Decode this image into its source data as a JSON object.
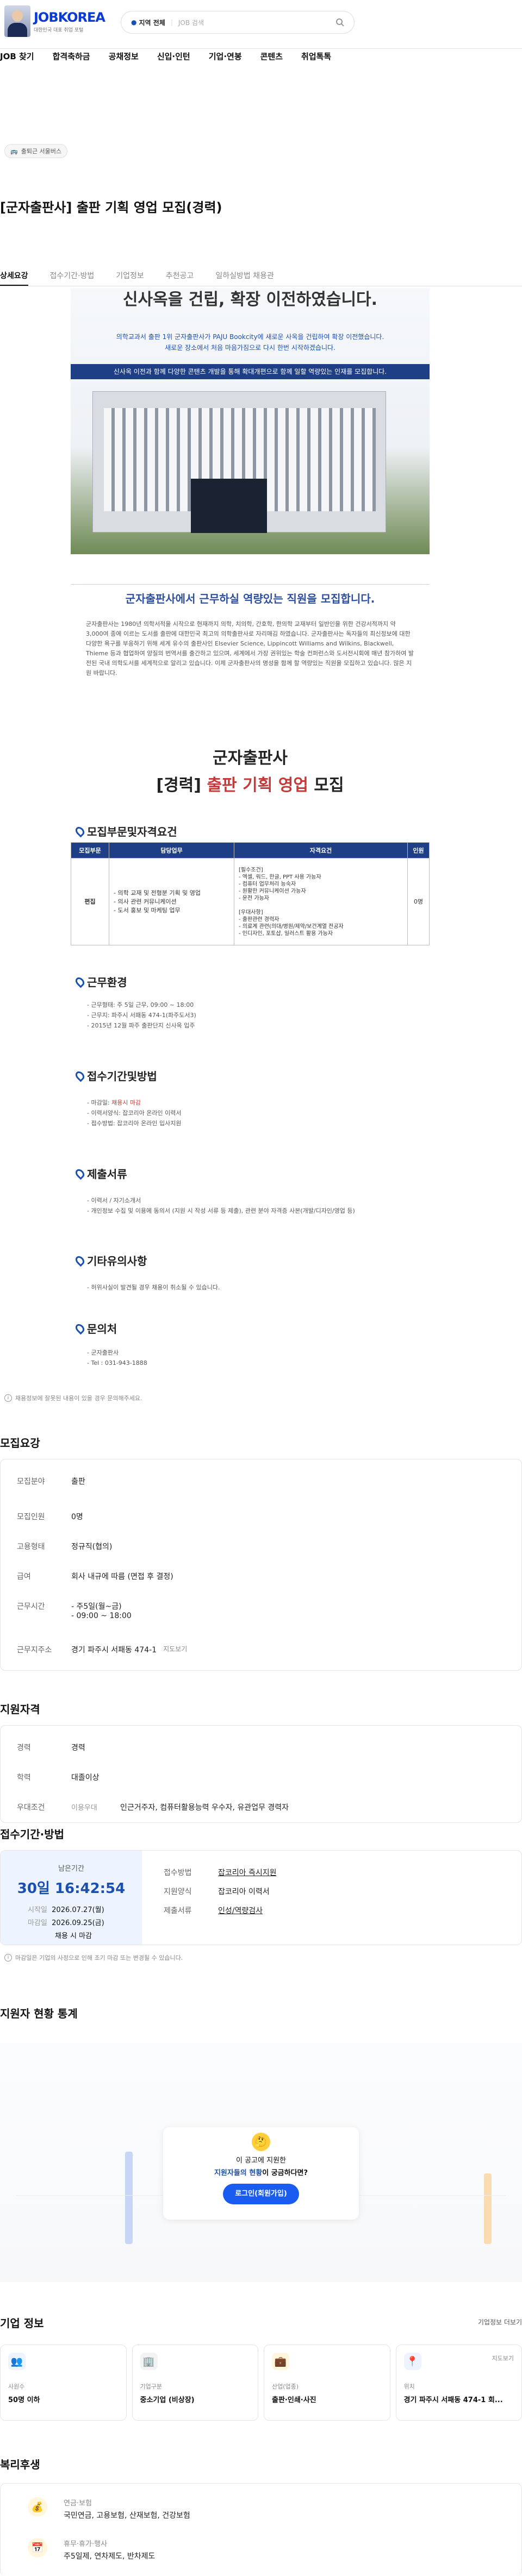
{
  "header": {
    "logo": "JOBKOREA",
    "logo_sub": "대한민국 대표 취업 포털",
    "location": "지역 전체",
    "search_placeholder": "JOB 검색"
  },
  "nav": [
    "JOB 찾기",
    "합격축하금",
    "공채정보",
    "신입·인턴",
    "기업·연봉",
    "콘텐츠",
    "취업톡톡"
  ],
  "tag": "출퇴근 서울버스",
  "title": "[군자출판사] 출판 기획 영업 모집(경력)",
  "tabs": [
    "상세요강",
    "접수기간·방법",
    "기업정보",
    "추천공고",
    "일하실방법 채용관"
  ],
  "poster": {
    "banner_l1": "신사옥을 건립, 확장 이전하였습니다.",
    "banner_p1": "의학교과서 출판 1위 군자출판사가 PAJU Bookcity에 새로운 사옥을 건립하여 확장 이전했습니다.",
    "banner_p2": "새로운 장소에서 처음 마음가짐으로 다시 한번 시작하겠습니다.",
    "banner_bar": "신사옥 이전과 함께 다양한 콘텐츠 개발을 통해 확대개편으로 함께 일할 역량있는 인재를 모집합니다.",
    "headline": "군자출판사에서 근무하실 역량있는 직원을 모집합니다.",
    "intro": "군자출판사는 1980년 의학서적을 시작으로 현재까지 의학, 치의학, 간호학, 한의학 교재부터 일반인을 위한 건강서적까지 약 3,000여 종에 이르는 도서를 출판에 대한민국 최고의 의학출판사로 자리매김 하였습니다. 군자출판사는 독자들의 최신정보에 대한 다양한 욕구를 부응하기 위해 세계 유수의 출판사인 Elsevier Science, Lippincott Williams and Wilkins, Blackwell, Thieme 등과 협업하여 양질의 번역서를 출간하고 있으며, 세계에서 가장 권위있는 학술 컨퍼런스와 도서전시회에 매년 참가하여 발전된 국내 의학도서를 세계적으로 알리고 있습니다. 이제 군자출판사의 명성을 함께 할 역량있는 직원을 모집하고 있습니다. 많은 지원 바랍니다.",
    "company": "군자출판사",
    "role_a": "[경력] ",
    "role_b": "출판 기획 영업",
    "role_c": " 모집",
    "sec_recruit": "모집부문및자격요건",
    "th": [
      "모집부문",
      "담당업무",
      "자격요건",
      "인원"
    ],
    "td_part": "편집",
    "td_duty": "- 의학 교재 및 전형분 기획 및 영업\n- 의사 관련 커뮤니케이션\n- 도서 홍보 및 마케팅 업무",
    "td_req": "[필수조건]\n- 엑셀, 워드, 한글, PPT 사용 가능자\n- 컴퓨터 업무처리 능숙자\n- 원활한 커뮤니케이션 가능자\n- 운전 가능자\n\n[우대사항]\n- 출판관련 경력자\n- 의료계 관련(의대/병원/제약/보건계열 전공자\n- 인디자인, 포토샵, 일러스트 활용 가능자",
    "td_cnt": "0명",
    "sec_env": "근무환경",
    "env": [
      "- 근무형태: 주 5일 근무, 09:00 ~ 18:00",
      "- 근무지: 파주시 서패동 474-1(파주도서3)",
      "- 2015년 12월 파주 출판단지 신사옥 입주"
    ],
    "sec_period": "접수기간및방법",
    "period": [
      "- 마감일: ",
      "채용시 마감",
      "- 이력서양식: 잡코리아 온라인 이력서",
      "- 접수방법: 잡코리아 온라인 입사지원"
    ],
    "sec_docs": "제출서류",
    "docs": [
      "- 이력서 / 자기소개서",
      "- 개인정보 수집 및 이용에 동의서 (지원 시 작성 서류 등 제출), 관련 분야 자격증 사본(개발/디자인/영업 등)"
    ],
    "sec_etc": "기타유의사항",
    "etc": "- 허위사실이 발견될 경우 채용이 취소될 수 있습니다.",
    "sec_contact": "문의처",
    "contact": [
      "- 군자출판사",
      "- Tel : 031-943-1888"
    ]
  },
  "report": "채용정보에 잘못된 내용이 있을 경우 문의해주세요.",
  "requirements": {
    "title": "모집요강",
    "rows": [
      [
        "모집분야",
        "출판"
      ],
      [
        "모집인원",
        "0명"
      ],
      [
        "고용형태",
        "정규직(협의)"
      ],
      [
        "급여",
        "회사 내규에 따름 (면접 후 결정)"
      ],
      [
        "근무시간",
        "- 주5일(월~금)"
      ],
      [
        "",
        "- 09:00 ~ 18:00"
      ],
      [
        "근무지주소",
        "경기 파주시 서패동 474-1"
      ]
    ],
    "map_link": "지도보기"
  },
  "qual": {
    "title": "지원자격",
    "rows": [
      [
        "경력",
        "경력"
      ],
      [
        "학력",
        "대졸이상"
      ],
      [
        "우대조건",
        "이용우대",
        "인근거주자, 컴퓨터활용능력 우수자, 유관업무 경력자"
      ]
    ]
  },
  "apply": {
    "title": "접수기간·방법",
    "remain_label": "남은기간",
    "remain": "30일 16:42:54",
    "start_k": "시작일",
    "start_v": "2026.07.27(월)",
    "end_k": "마감일",
    "end_v": "2026.09.25(금)",
    "close": "채용 시 마감",
    "method_k": "접수방법",
    "method_v": "잡코리아 즉시지원",
    "form_k": "지원양식",
    "form_v": "잡코리아 이력서",
    "docs_k": "제출서류",
    "docs_v": "인성/역량검사",
    "note": "마감일은 기업의 사정으로 인해 조기 마감 또는 변경될 수 있습니다."
  },
  "stats": {
    "title": "지원자 현황 통계",
    "q1": "이 공고에 지원한",
    "q2a": "지원자들의 현황",
    "q2b": "이 궁금하다면?",
    "btn": "로그인(회원가입)"
  },
  "company": {
    "title": "기업 정보",
    "more": "기업정보 더보기",
    "cards": [
      [
        "사원수",
        "50명 이하"
      ],
      [
        "기업구분",
        "중소기업 (비상장)"
      ],
      [
        "산업(업종)",
        "출판·인쇄·사진"
      ],
      [
        "위치",
        "경기 파주시 서패동 474-1 회..."
      ]
    ],
    "map": "지도보기"
  },
  "welfare": {
    "title": "복리후생",
    "items": [
      [
        "연금·보험",
        "국민연금, 고용보험, 산재보험, 건강보험"
      ],
      [
        "휴무·휴가·행사",
        "주5일제, 연차제도, 반차제도"
      ]
    ]
  },
  "colors": {
    "brand": "#0a3bd6",
    "accent": "#1a4fb4",
    "red": "#c43a3a"
  }
}
